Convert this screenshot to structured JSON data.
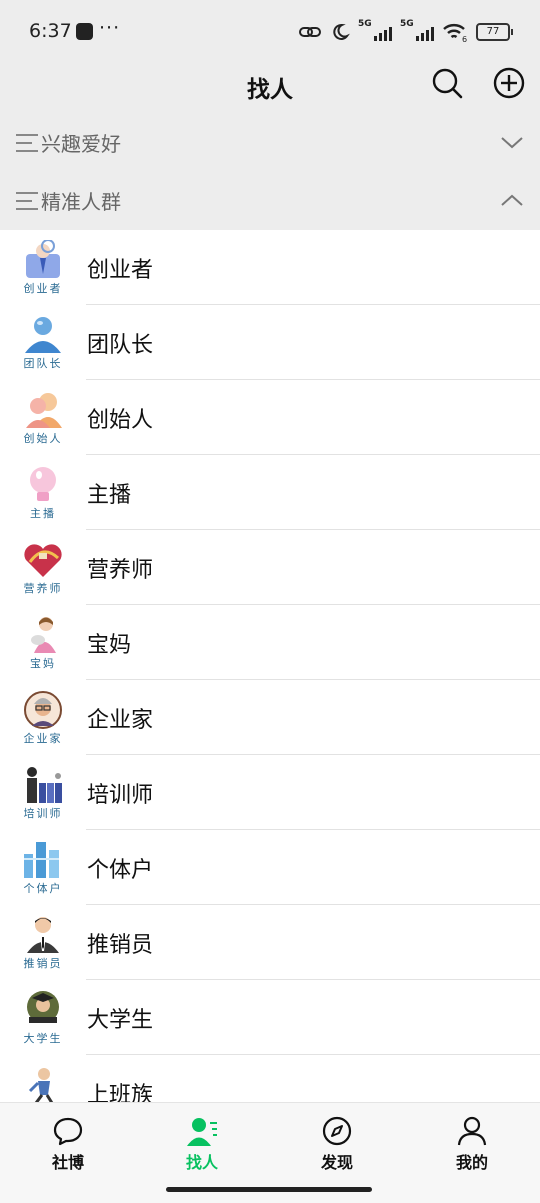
{
  "status": {
    "time": "6:37",
    "dots": "···",
    "sig1": "5G",
    "sig2": "5G",
    "wifi_sub": "6",
    "battery": "77"
  },
  "header": {
    "title": "找人"
  },
  "sections": [
    {
      "label": "兴趣爱好",
      "expanded": false
    },
    {
      "label": "精准人群",
      "expanded": true
    }
  ],
  "rows": [
    {
      "label": "创业者",
      "caption": "创业者",
      "icon": "businessman-icon"
    },
    {
      "label": "团队长",
      "caption": "团队长",
      "icon": "leader-icon"
    },
    {
      "label": "创始人",
      "caption": "创始人",
      "icon": "founder-icon"
    },
    {
      "label": "主播",
      "caption": "主播",
      "icon": "lightbulb-icon"
    },
    {
      "label": "营养师",
      "caption": "营养师",
      "icon": "heart-icon"
    },
    {
      "label": "宝妈",
      "caption": "宝妈",
      "icon": "mother-icon"
    },
    {
      "label": "企业家",
      "caption": "企业家",
      "icon": "entrepreneur-icon"
    },
    {
      "label": "培训师",
      "caption": "培训师",
      "icon": "trainer-icon"
    },
    {
      "label": "个体户",
      "caption": "个体户",
      "icon": "shop-icon"
    },
    {
      "label": "推销员",
      "caption": "推销员",
      "icon": "salesman-icon"
    },
    {
      "label": "大学生",
      "caption": "大学生",
      "icon": "student-icon"
    },
    {
      "label": "上班族",
      "caption": "",
      "icon": "worker-icon"
    }
  ],
  "tabs": [
    {
      "label": "社博",
      "active": false
    },
    {
      "label": "找人",
      "active": true
    },
    {
      "label": "发现",
      "active": false
    },
    {
      "label": "我的",
      "active": false
    }
  ],
  "colors": {
    "accent": "#07c160",
    "caption": "#2a6a92",
    "background": "#ededed"
  }
}
